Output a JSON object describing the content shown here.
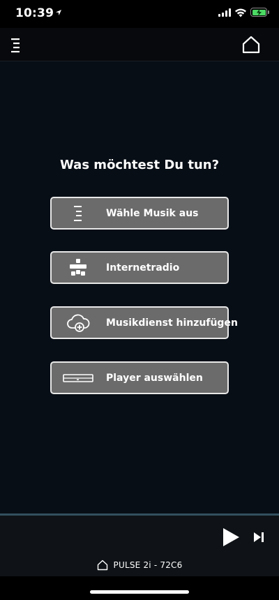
{
  "status_bar": {
    "time": "10:39"
  },
  "main": {
    "question": "Was möchtest Du tun?",
    "actions": [
      {
        "label": "Wähle Musik aus",
        "icon": "music-list-icon"
      },
      {
        "label": "Internetradio",
        "icon": "tunein-radio-icon"
      },
      {
        "label": "Musikdienst hinzufügen",
        "icon": "cloud-add-icon"
      },
      {
        "label": "Player auswählen",
        "icon": "speaker-device-icon"
      }
    ]
  },
  "player": {
    "device_name": "PULSE 2i - 72C6"
  },
  "colors": {
    "background": "#080e16",
    "button_fill": "#6b6b6b",
    "button_border": "#e8e8e8",
    "accent_divider": "#33505e"
  }
}
